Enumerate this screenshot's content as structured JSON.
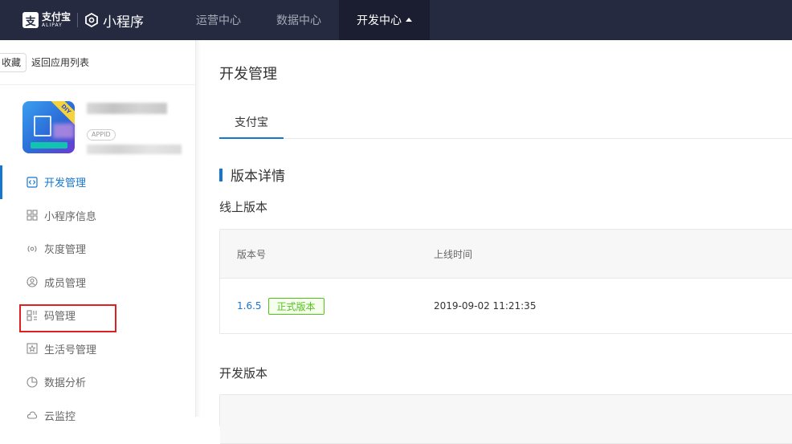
{
  "topbar": {
    "alipay_logo_glyph": "支",
    "alipay_cn": "支付宝",
    "alipay_en": "ALIPAY",
    "product": "小程序",
    "nav": [
      {
        "label": "运营中心"
      },
      {
        "label": "数据中心"
      },
      {
        "label": "开发中心"
      }
    ]
  },
  "sidebar": {
    "favorite_label": "收藏",
    "back_label": "返回应用列表",
    "app": {
      "icon_ribbon": "DIY",
      "appid_tag": "APPID"
    },
    "menu": [
      {
        "label": "开发管理",
        "icon": "code-icon"
      },
      {
        "label": "小程序信息",
        "icon": "grid-icon"
      },
      {
        "label": "灰度管理",
        "icon": "broadcast-icon"
      },
      {
        "label": "成员管理",
        "icon": "user-circle-icon"
      },
      {
        "label": "码管理",
        "icon": "qrcode-icon"
      },
      {
        "label": "生活号管理",
        "icon": "star-square-icon"
      },
      {
        "label": "数据分析",
        "icon": "pie-chart-icon"
      },
      {
        "label": "云监控",
        "icon": "cloud-icon"
      }
    ]
  },
  "main": {
    "title": "开发管理",
    "tab": "支付宝",
    "section_title": "版本详情",
    "online": {
      "title": "线上版本",
      "headers": {
        "version": "版本号",
        "time": "上线时间"
      },
      "row": {
        "version": "1.6.5",
        "badge": "正式版本",
        "time": "2019-09-02 11:21:35"
      }
    },
    "dev": {
      "title": "开发版本"
    }
  },
  "colors": {
    "topbar_bg": "#252a40",
    "accent": "#1677d2",
    "success": "#52c41a",
    "highlight": "#e02020"
  }
}
